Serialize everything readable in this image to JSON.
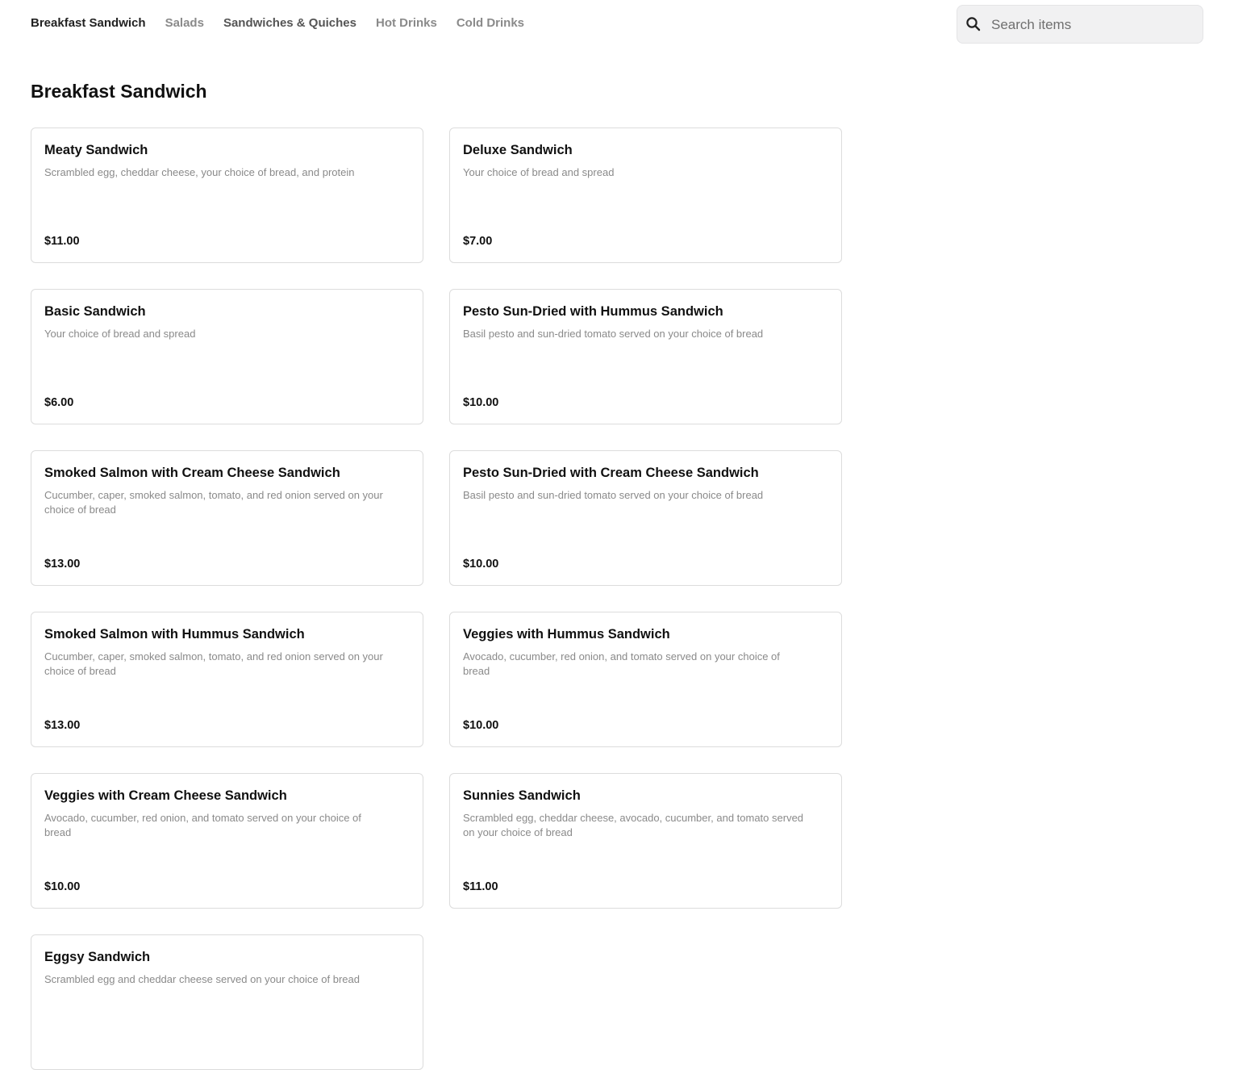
{
  "nav": {
    "tabs": [
      {
        "label": "Breakfast Sandwich",
        "state": "active"
      },
      {
        "label": "Salads",
        "state": "inactive"
      },
      {
        "label": "Sandwiches & Quiches",
        "state": "semi"
      },
      {
        "label": "Hot Drinks",
        "state": "inactive"
      },
      {
        "label": "Cold Drinks",
        "state": "inactive"
      }
    ]
  },
  "search": {
    "placeholder": "Search items",
    "value": "",
    "icon": "search-icon"
  },
  "section": {
    "title": "Breakfast Sandwich"
  },
  "items": [
    {
      "name": "Meaty Sandwich",
      "description": "Scrambled egg, cheddar cheese, your choice of bread, and protein",
      "price": "$11.00"
    },
    {
      "name": "Deluxe Sandwich",
      "description": "Your choice of bread and spread",
      "price": "$7.00"
    },
    {
      "name": "Basic Sandwich",
      "description": "Your choice of bread and spread",
      "price": "$6.00"
    },
    {
      "name": "Pesto Sun-Dried with Hummus Sandwich",
      "description": "Basil pesto and sun-dried tomato served on your choice of bread",
      "price": "$10.00"
    },
    {
      "name": "Smoked Salmon with Cream Cheese Sandwich",
      "description": "Cucumber, caper, smoked salmon, tomato, and red onion served on your choice of bread",
      "price": "$13.00"
    },
    {
      "name": "Pesto Sun-Dried with Cream Cheese Sandwich",
      "description": "Basil pesto and sun-dried tomato served on your choice of bread",
      "price": "$10.00"
    },
    {
      "name": "Smoked Salmon with Hummus Sandwich",
      "description": "Cucumber, caper, smoked salmon, tomato, and red onion served on your choice of bread",
      "price": "$13.00"
    },
    {
      "name": "Veggies with Hummus Sandwich",
      "description": "Avocado, cucumber, red onion, and tomato served on your choice of bread",
      "price": "$10.00"
    },
    {
      "name": "Veggies with Cream Cheese Sandwich",
      "description": "Avocado, cucumber, red onion, and tomato served on your choice of bread",
      "price": "$10.00"
    },
    {
      "name": "Sunnies Sandwich",
      "description": "Scrambled egg, cheddar cheese, avocado, cucumber, and tomato served on your choice of bread",
      "price": "$11.00"
    },
    {
      "name": "Eggsy Sandwich",
      "description": "Scrambled egg and cheddar cheese served on your choice of bread",
      "price": ""
    }
  ],
  "colors": {
    "text": "#111111",
    "muted": "#8a8a8a",
    "border": "#dcdcdc",
    "search_bg": "#f1f1f2"
  }
}
